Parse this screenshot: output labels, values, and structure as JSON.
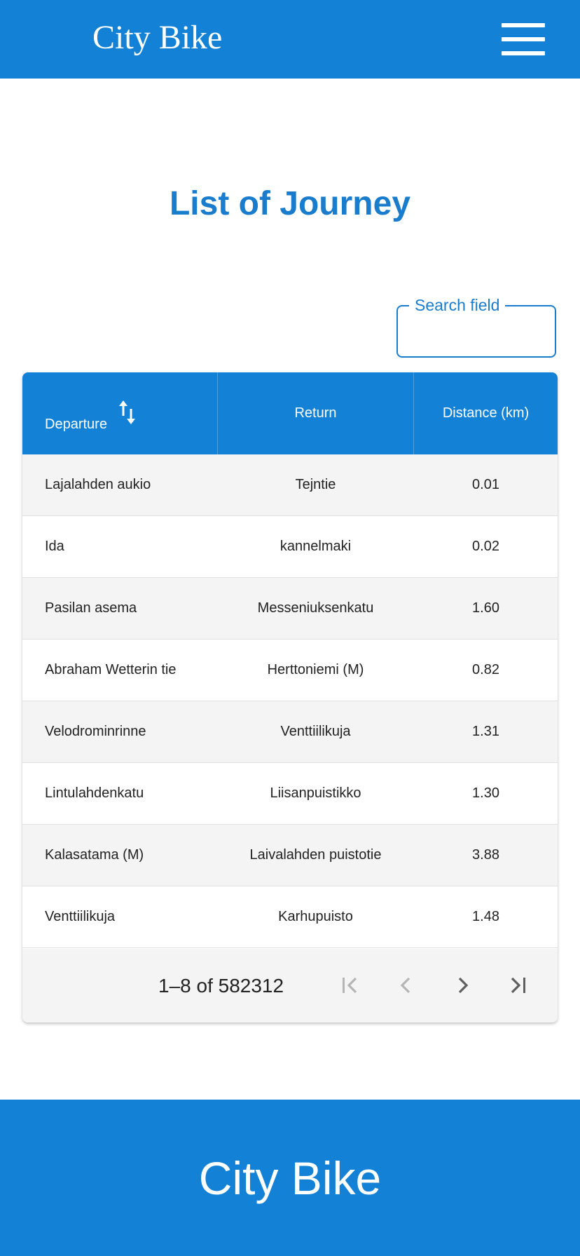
{
  "header": {
    "brand": "City Bike",
    "menu_icon": "hamburger-menu-icon"
  },
  "main": {
    "title": "List of Journey"
  },
  "search": {
    "label": "Search field",
    "value": ""
  },
  "table": {
    "columns": [
      "Departure",
      "Return",
      "Distance (km)"
    ],
    "sort_icon": "swap-vertical-icon",
    "rows": [
      {
        "departure": "Lajalahden aukio",
        "return": "Tejntie",
        "distance": "0.01"
      },
      {
        "departure": "Ida",
        "return": "kannelmaki",
        "distance": "0.02"
      },
      {
        "departure": "Pasilan asema",
        "return": "Messeniuksenkatu",
        "distance": "1.60"
      },
      {
        "departure": "Abraham Wetterin tie",
        "return": "Herttoniemi (M)",
        "distance": "0.82"
      },
      {
        "departure": "Velodrominrinne",
        "return": "Venttiilikuja",
        "distance": "1.31"
      },
      {
        "departure": "Lintulahdenkatu",
        "return": "Liisanpuistikko",
        "distance": "1.30"
      },
      {
        "departure": "Kalasatama (M)",
        "return": "Laivalahden puistotie",
        "distance": "3.88"
      },
      {
        "departure": "Venttiilikuja",
        "return": "Karhupuisto",
        "distance": "1.48"
      }
    ]
  },
  "pagination": {
    "range_text": "1–8 of 582312",
    "first_disabled": true,
    "prev_disabled": true
  },
  "footer": {
    "title": "City Bike"
  },
  "colors": {
    "primary": "#1281d6",
    "title_text": "#1a7ccc",
    "row_alt": "#f4f4f4"
  }
}
